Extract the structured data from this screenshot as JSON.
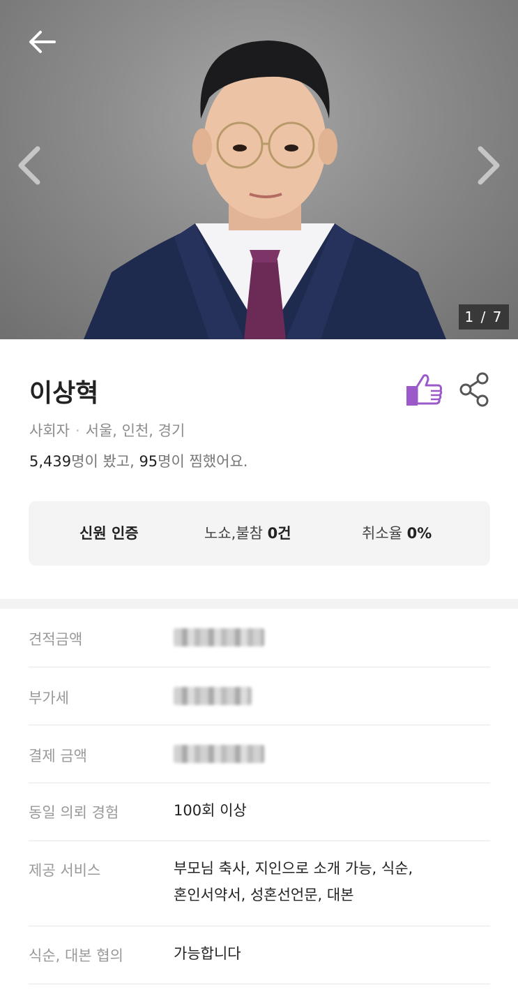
{
  "photo": {
    "counter_current": "1",
    "counter_total": "7",
    "counter_text": "1 / 7"
  },
  "profile": {
    "name": "이상혁",
    "role": "사회자",
    "region": "서울, 인천, 경기",
    "views": "5,439",
    "views_suffix": "명이 봤고, ",
    "favorites": "95",
    "favorites_suffix": "명이 찜했어요."
  },
  "badges": {
    "verified": "신원 인증",
    "noshow_label": "노쇼,불참",
    "noshow_value": "0건",
    "cancel_label": "취소율",
    "cancel_value": "0%"
  },
  "details": [
    {
      "label": "견적금액",
      "value": "",
      "blurred": true
    },
    {
      "label": "부가세",
      "value": "",
      "blurred": true
    },
    {
      "label": "결제 금액",
      "value": "",
      "blurred": true
    },
    {
      "label": "동일 의뢰 경험",
      "value": "100회 이상"
    },
    {
      "label": "제공 서비스",
      "value_line1": "부모님 축사, 지인으로 소개 가능, 식순,",
      "value_line2": "혼인서약서, 성혼선언문, 대본"
    },
    {
      "label": "식순, 대본 협의",
      "value": "가능합니다"
    }
  ],
  "colors": {
    "accent": "#9b59c9",
    "label_gray": "#999999"
  },
  "icons": {
    "back": "arrow-left-icon",
    "prev": "chevron-left-icon",
    "next": "chevron-right-icon",
    "like": "thumbs-up-icon",
    "share": "share-icon"
  }
}
